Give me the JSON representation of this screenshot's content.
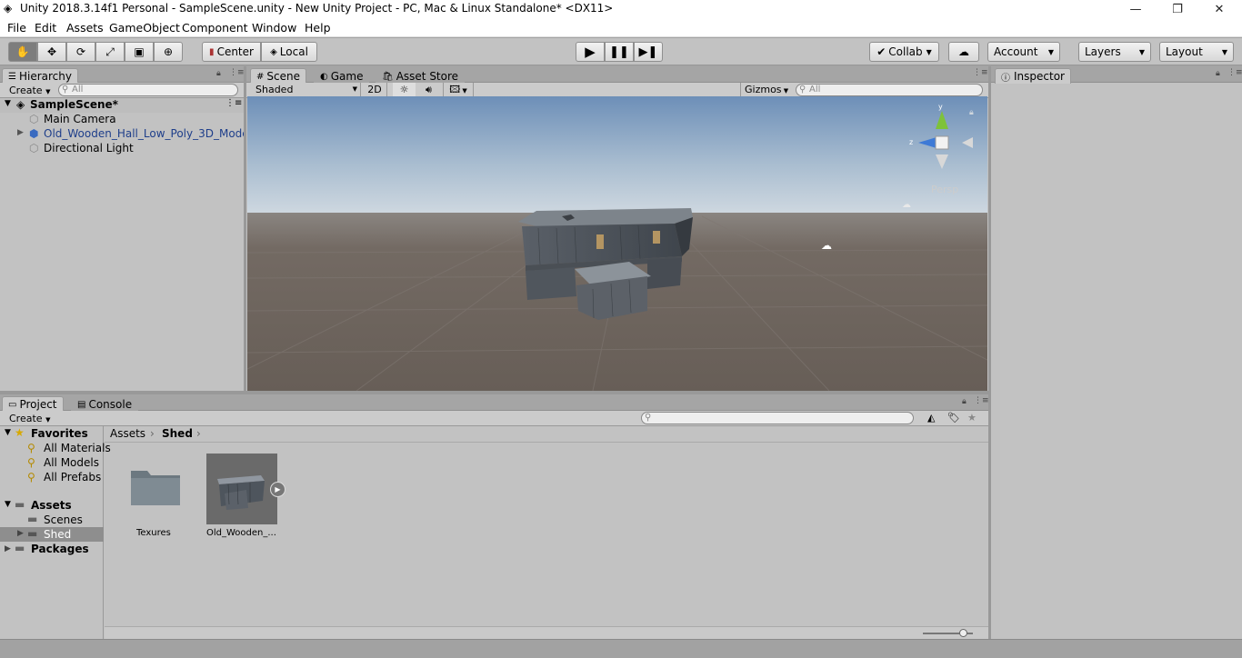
{
  "window": {
    "title": "Unity 2018.3.14f1 Personal - SampleScene.unity - New Unity Project - PC, Mac & Linux Standalone* <DX11>",
    "minimize": "—",
    "maximize": "❐",
    "close": "✕"
  },
  "menu": [
    "File",
    "Edit",
    "Assets",
    "GameObject",
    "Component",
    "Window",
    "Help"
  ],
  "toolbar": {
    "center": "Center",
    "local": "Local",
    "collab": "Collab",
    "account": "Account",
    "layers": "Layers",
    "layout": "Layout"
  },
  "hierarchy": {
    "tab": "Hierarchy",
    "create": "Create",
    "search_placeholder": "All",
    "scene": "SampleScene*",
    "items": [
      "Main Camera",
      "Old_Wooden_Hall_Low_Poly_3D_Mode",
      "Directional Light"
    ]
  },
  "scene_tabs": {
    "scene": "Scene",
    "game": "Game",
    "asset_store": "Asset Store"
  },
  "scene_bar": {
    "shaded": "Shaded",
    "mode2d": "2D",
    "gizmos": "Gizmos",
    "search_placeholder": "All"
  },
  "gizmo": {
    "persp": "Persp",
    "y": "y",
    "z": "z"
  },
  "inspector": {
    "tab": "Inspector"
  },
  "bottom_tabs": {
    "project": "Project",
    "console": "Console"
  },
  "project": {
    "create": "Create",
    "favorites": "Favorites",
    "fav_items": [
      "All Materials",
      "All Models",
      "All Prefabs"
    ],
    "assets": "Assets",
    "asset_folders": [
      "Scenes",
      "Shed"
    ],
    "packages": "Packages",
    "breadcrumb": [
      "Assets",
      "Shed"
    ],
    "files": [
      "Texures",
      "Old_Wooden_..."
    ]
  },
  "colors": {
    "sky_top": "#6d8fb8",
    "sky_horizon": "#c9d5df",
    "ground": "#6b625c",
    "panel": "#c2c2c2",
    "selected": "#8e8e8e"
  }
}
